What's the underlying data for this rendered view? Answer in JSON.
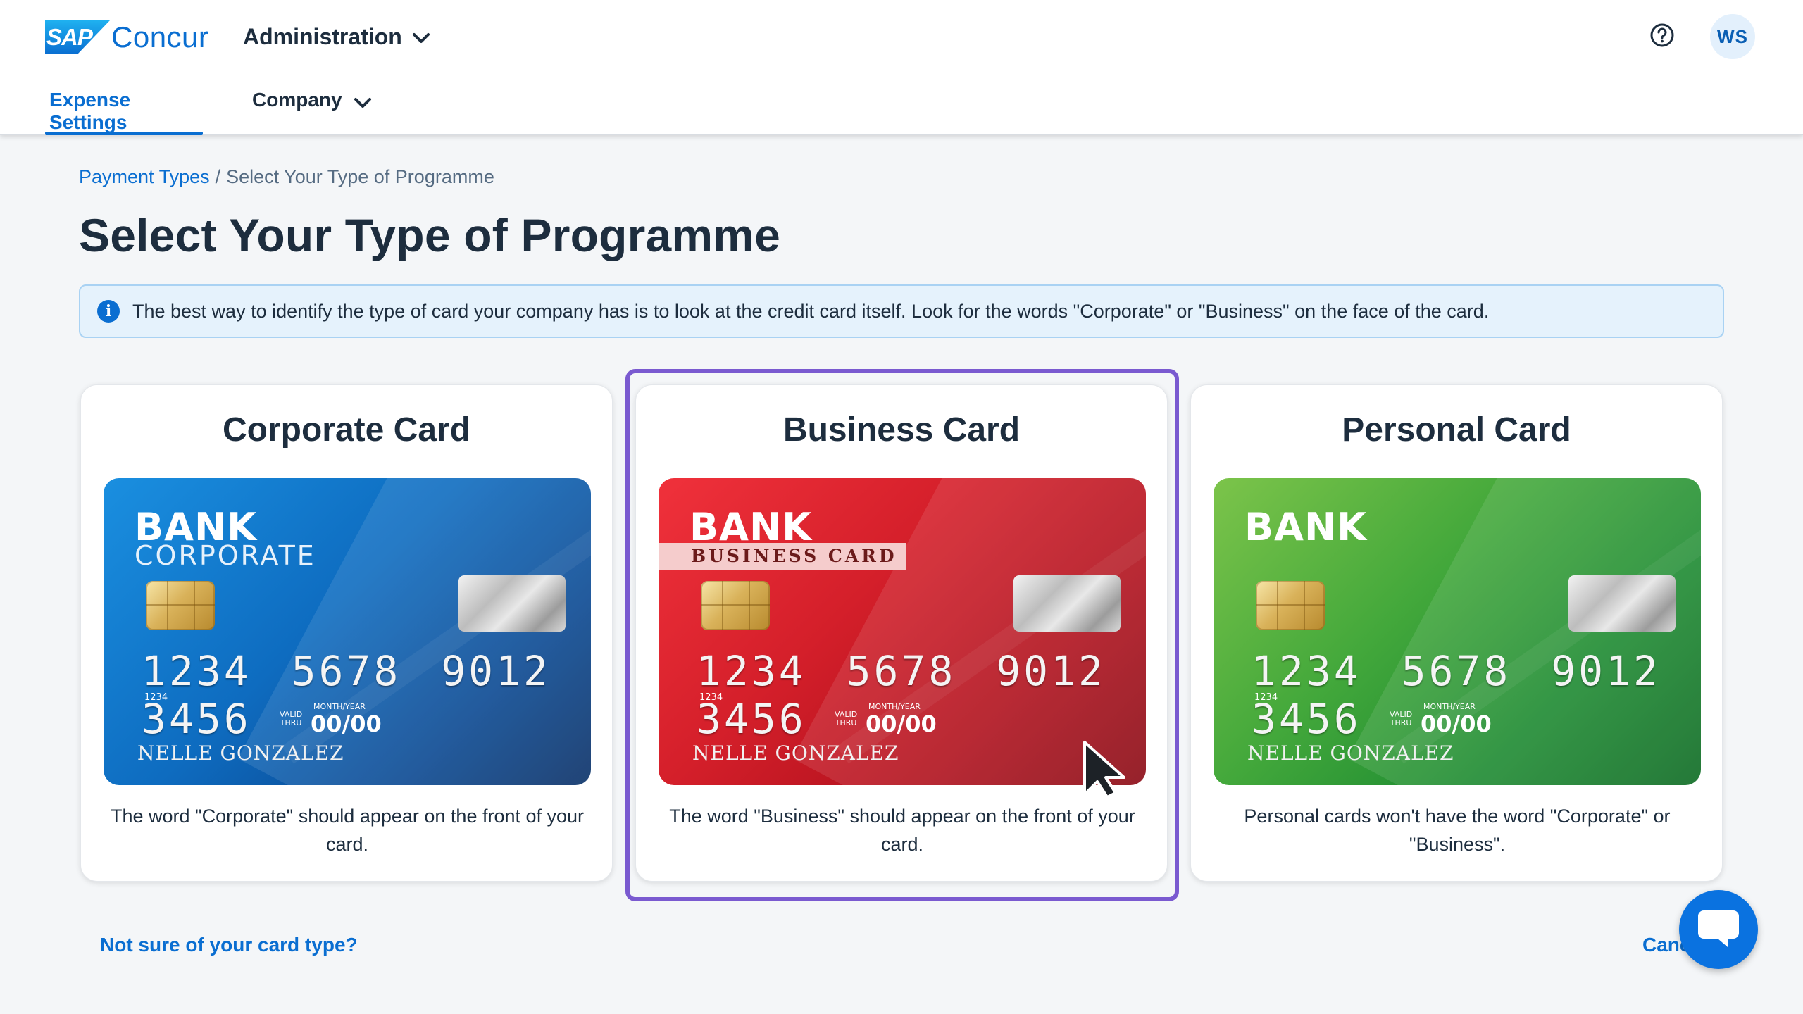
{
  "header": {
    "logo_sap": "SAP",
    "logo_product": "Concur",
    "admin_menu_label": "Administration",
    "help_icon": "help-circle-icon",
    "avatar_initials": "WS",
    "tabs": [
      {
        "label": "Expense Settings",
        "active": true
      },
      {
        "label": "Company",
        "active": false
      }
    ]
  },
  "breadcrumb": {
    "parent": "Payment Types",
    "separator": "/",
    "current": "Select Your Type of Programme"
  },
  "page_title": "Select Your Type of Programme",
  "info_message": "The best way to identify the type of card your company has is to look at the credit card itself. Look for the words \"Corporate\" or \"Business\" on the face of the card.",
  "options": [
    {
      "title": "Corporate Card",
      "description": "The word \"Corporate\" should appear on the front of your card.",
      "card": {
        "bank": "BANK",
        "subtitle": "CORPORATE",
        "number": "1234 5678 9012 3456",
        "small_number": "1234",
        "valid_label_1": "VALID",
        "valid_label_2": "THRU",
        "month_year_label": "MONTH/YEAR",
        "expiry": "00/00",
        "holder": "NELLE GONZALEZ",
        "color": "#0e6cc0"
      }
    },
    {
      "title": "Business Card",
      "description": "The word \"Business\" should appear on the front of your card.",
      "selected": true,
      "card": {
        "bank": "BANK",
        "subtitle": "BUSINESS CARD",
        "number": "1234 5678 9012 3456",
        "small_number": "1234",
        "valid_label_1": "VALID",
        "valid_label_2": "THRU",
        "month_year_label": "MONTH/YEAR",
        "expiry": "00/00",
        "holder": "NELLE GONZALEZ",
        "color": "#d41f2a"
      }
    },
    {
      "title": "Personal Card",
      "description": "Personal cards won't have the word \"Corporate\" or \"Business\".",
      "card": {
        "bank": "BANK",
        "number": "1234 5678 9012 3456",
        "small_number": "1234",
        "valid_label_1": "VALID",
        "valid_label_2": "THRU",
        "month_year_label": "MONTH/YEAR",
        "expiry": "00/00",
        "holder": "NELLE GONZALEZ",
        "color": "#43a83b"
      }
    }
  ],
  "footer": {
    "not_sure_link": "Not sure of your card type?",
    "cancel_link": "Canc"
  },
  "colors": {
    "accent": "#0a6ed1",
    "selection": "#7a5ad0",
    "info_bg": "#e5f2fc"
  }
}
